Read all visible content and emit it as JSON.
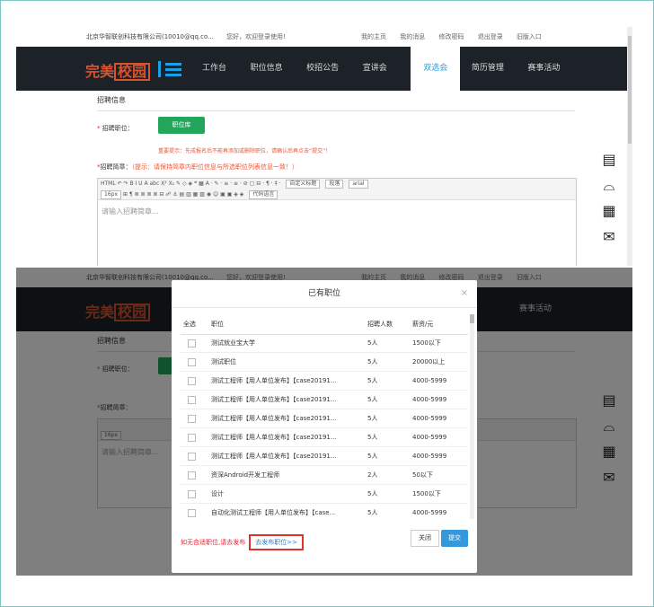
{
  "topbar": {
    "company": "北京华智联创科技有限公司(10010@qq.co...",
    "welcome": "您好，欢迎登录使用!",
    "links": [
      "我的主页",
      "我的消息",
      "修改密码",
      "退出登录",
      "旧版入口"
    ]
  },
  "brand": {
    "text1": "完美",
    "text2": "校园"
  },
  "nav": {
    "items": [
      "工作台",
      "职位信息",
      "校招公告",
      "宣讲会",
      "双选会",
      "简历管理",
      "赛事活动"
    ],
    "active": "双选会"
  },
  "form": {
    "section_title": "招聘信息",
    "position_label": "招聘职位：",
    "position_button": "职位库",
    "warning": "重要提示：先成报名后不能再添加或删除职位，请确认后再点击“提交”！",
    "brief_label": "招聘简章：",
    "brief_hint": "（提示：请保持简章内职位信息与所选职位列表信息一致！）",
    "required_mark": "*",
    "editor_placeholder": "请输入招聘简章...",
    "toolbar_row1": "HTML ↶ ↷ B I U A abc X² X₂ ✎ ◇ ◈ ❝ ▦ A · ✎ · ≡ · ≡ · ⊘ ▢ ⊟ · ¶ · ‡ ·",
    "toolbar_row2": "⊞ ¶ ≣ ≣ ≣ ≣ ⊟ ☍ ⚓ ▤ ▥ ▦ ▧ ◉ ☺ ▣ ▣ ◈ ◈",
    "font_size": "16px",
    "custom_title": "自定义标题",
    "paragraph": "段落",
    "font_family": "arial",
    "code_lang": "代码语言"
  },
  "modal": {
    "title": "已有职位",
    "close": "×",
    "headers": {
      "all": "全选",
      "position": "职位",
      "count": "招聘人数",
      "salary": "薪资/元"
    },
    "rows": [
      {
        "position": "测试就业宝大学",
        "count": "5人",
        "salary": "1500以下"
      },
      {
        "position": "测试职位",
        "count": "5人",
        "salary": "20000以上"
      },
      {
        "position": "测试工程师【用人单位发布】【case20191...",
        "count": "5人",
        "salary": "4000-5999"
      },
      {
        "position": "测试工程师【用人单位发布】【case20191...",
        "count": "5人",
        "salary": "4000-5999"
      },
      {
        "position": "测试工程师【用人单位发布】【case20191...",
        "count": "5人",
        "salary": "4000-5999"
      },
      {
        "position": "测试工程师【用人单位发布】【case20191...",
        "count": "5人",
        "salary": "4000-5999"
      },
      {
        "position": "测试工程师【用人单位发布】【case20191...",
        "count": "5人",
        "salary": "4000-5999"
      },
      {
        "position": "资深Android开发工程师",
        "count": "2人",
        "salary": "50以下"
      },
      {
        "position": "设计",
        "count": "5人",
        "salary": "1500以下"
      },
      {
        "position": "自动化测试工程师【用人单位发布】【case...",
        "count": "5人",
        "salary": "4000-5999"
      }
    ],
    "footer_text": "如无合适职位,请去发布",
    "footer_link": "去发布职位>>",
    "close_button": "关闭",
    "submit_button": "提交"
  },
  "colors": {
    "nav_bg": "#1d2228",
    "accent": "#2b9de0",
    "green": "#23a55c",
    "danger": "#e23"
  },
  "sidebar_icons": [
    "document-icon",
    "headset-icon",
    "qrcode-icon",
    "chat-icon"
  ]
}
